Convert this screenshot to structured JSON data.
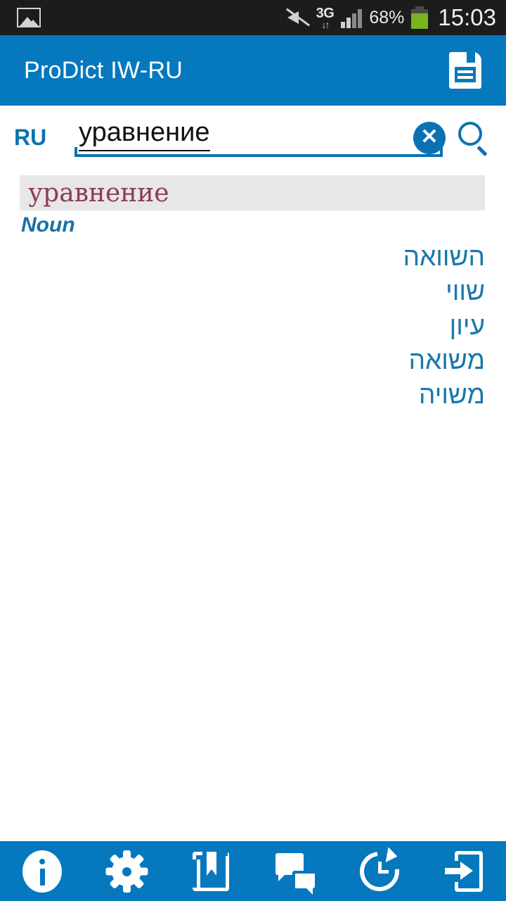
{
  "status_bar": {
    "gallery_icon": "gallery-icon",
    "mute_icon": "sound-muted-icon",
    "network_type": "3G",
    "data_arrows": "↓↑",
    "signal_icon": "signal-bars-icon",
    "battery_percent": "68%",
    "battery_icon": "battery-icon",
    "time": "15:03",
    "background": "#1c1c1c"
  },
  "app_bar": {
    "title": "ProDict IW-RU",
    "save_icon": "save-floppy-icon",
    "background": "#0578be"
  },
  "search": {
    "language_tag": "RU",
    "value": "уравнение",
    "placeholder": "",
    "clear_icon": "clear-circle-icon",
    "clear_glyph": "✕",
    "search_icon": "search-magnifier-icon",
    "accent": "#0a72b3"
  },
  "result": {
    "headword": "уравнение",
    "headword_color": "#8e3a59",
    "band_color": "#e7e7e7",
    "part_of_speech": "Noun",
    "pos_color": "#1871a6",
    "translations": [
      "השוואה",
      "שווי",
      "עיון",
      "משואה",
      "משויה"
    ],
    "translation_color": "#1878ac"
  },
  "bottom_bar": {
    "background": "#0578be",
    "items": [
      {
        "name": "info-icon",
        "label": "Info"
      },
      {
        "name": "gear-icon",
        "label": "Settings"
      },
      {
        "name": "book-bookmark-icon",
        "label": "Dictionaries"
      },
      {
        "name": "chat-icon",
        "label": "Chat"
      },
      {
        "name": "history-icon",
        "label": "History"
      },
      {
        "name": "exit-icon",
        "label": "Exit"
      }
    ]
  }
}
